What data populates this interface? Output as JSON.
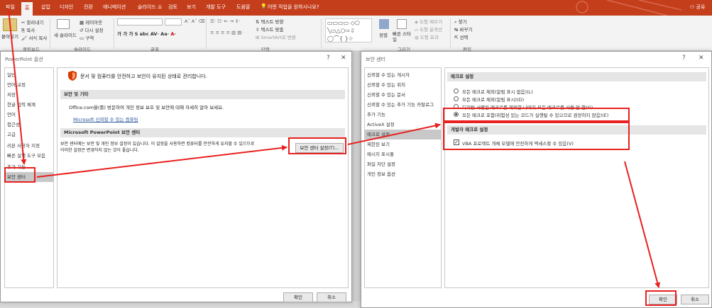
{
  "ribbon": {
    "tabs": [
      "파일",
      "홈",
      "삽입",
      "디자인",
      "전환",
      "애니메이션",
      "슬라이드 쇼",
      "검토",
      "보기",
      "개발 도구",
      "도움말"
    ],
    "tell_me": "어떤 작업을 원하시나요?",
    "share": "공유",
    "clipboard": {
      "paste": "붙여넣기",
      "cut": "잘라내기",
      "copy": "복사",
      "format_painter": "서식 복사",
      "label": "클립보드"
    },
    "slides": {
      "new_slide": "새 슬라이드",
      "layout": "레이아웃",
      "reset": "다시 설정",
      "section": "구역",
      "label": "슬라이드"
    },
    "font_label": "글꼴",
    "paragraph": {
      "text_direction": "텍스트 방향",
      "align_text": "텍스트 맞춤",
      "smartart": "SmartArt로 변환",
      "label": "단락"
    },
    "drawing": {
      "arrange": "정렬",
      "quick_styles": "빠른 스타일",
      "fill": "도형 채우기",
      "outline": "도형 윤곽선",
      "effects": "도형 효과",
      "label": "그리기"
    },
    "editing": {
      "find": "찾기",
      "replace": "바꾸기",
      "select": "선택",
      "label": "편집"
    }
  },
  "options_dialog": {
    "title": "PowerPoint 옵션",
    "nav": [
      "일반",
      "언어 교정",
      "저장",
      "한글 입력 체계",
      "언어",
      "접근성",
      "고급",
      "리본 사용자 지정",
      "빠른 실행 도구 모음",
      "추가 기능",
      "보안 센터"
    ],
    "banner": "문서 및 컴퓨터를 안전하고 보안이 유지된 상태로 관리합니다.",
    "section1": "보안 및 기타",
    "section1_text": "Office.com을(를) 방문하여 개인 정보 보호 및 보안에 대해 자세히 알아 보세요.",
    "section1_link": "Microsoft 신뢰할 수 있는 컴퓨팅",
    "section2": "Microsoft PowerPoint 보안 센터",
    "section2_text_line1": "보안 센터에는 보안 및 개인 정보 설정이 있습니다. 이 설정을 사용하면 컴퓨터를 안전하게 유지할 수 있으므로",
    "section2_text_line2": "이러한 설정은 변경하지 않는 것이 좋습니다.",
    "trust_center_button": "보안 센터 설정(T)...",
    "ok": "확인",
    "cancel": "취소"
  },
  "trust_dialog": {
    "title": "보안 센터",
    "nav": [
      "신뢰할 수 있는 게시자",
      "신뢰할 수 있는 위치",
      "신뢰할 수 있는 문서",
      "신뢰할 수 있는 추가 기능 카탈로그",
      "추가 기능",
      "ActiveX 설정",
      "매크로 설정",
      "제한된 보기",
      "메시지 표시줄",
      "파일 차단 설정",
      "개인 정보 옵션"
    ],
    "macro_header": "매크로 설정",
    "options": [
      "모든 매크로 제외(알림 표시 없음)(L)",
      "모든 매크로 제외(알림 표시)(D)",
      "디지털 서명된 매크로를 제외한 나머지 모든 매크로를 사용 안 함(G)",
      "모든 매크로 포함(위험성 있는 코드가 실행될 수 있으므로 권장하지 않음)(E)"
    ],
    "selected_option": 3,
    "dev_header": "개발자 매크로 설정",
    "vba_checkbox": "VBA 프로젝트 개체 모델에 안전하게 액세스할 수 있음(V)",
    "vba_checked": true,
    "ok": "확인",
    "cancel": "취소"
  },
  "colors": {
    "accent": "#c43e1c",
    "annotation": "#e8201f"
  }
}
